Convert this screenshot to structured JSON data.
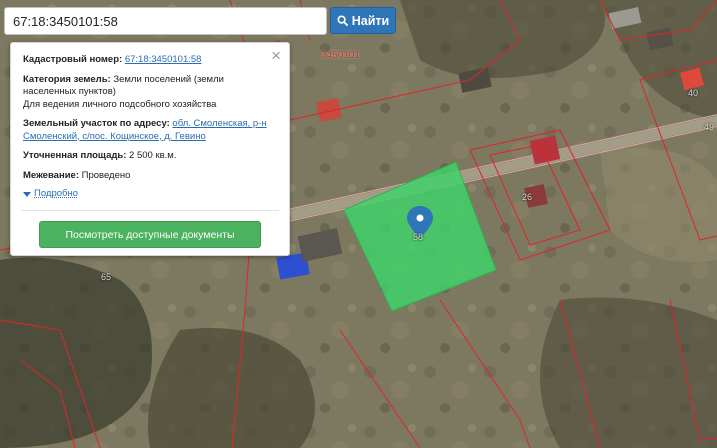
{
  "search": {
    "value": "67:18:3450101:58",
    "button_label": "Найти"
  },
  "popup": {
    "cadastral_label": "Кадастровый номер:",
    "cadastral_value": "67:18:3450101:58",
    "category_label": "Категория земель:",
    "category_value": "Земли поселений (земли населенных пунктов)",
    "usage_value": "Для ведения личного подсобного хозяйства",
    "address_label": "Земельный участок по адресу:",
    "address_value": "обл. Смоленская, р-н Смоленский, с/пос. Кощинское, д. Гевино",
    "area_label": "Уточненная площадь:",
    "area_value": "2 500 кв.м.",
    "survey_label": "Межевание:",
    "survey_value": "Проведено",
    "more_label": "Подробно",
    "docs_button": "Посмотреть доступные документы",
    "close_symbol": "×"
  },
  "map": {
    "parcel_labels": {
      "quarter": "3450101",
      "plot_58": "58",
      "plot_26": "26",
      "plot_65": "65",
      "plot_49": "49",
      "plot_40": "40"
    },
    "colors": {
      "selected_parcel": "#3fd46a",
      "parcel_border": "#e0242a",
      "marker": "#2f76b8",
      "button_primary": "#2f76b8",
      "button_docs": "#4bb25f"
    }
  }
}
